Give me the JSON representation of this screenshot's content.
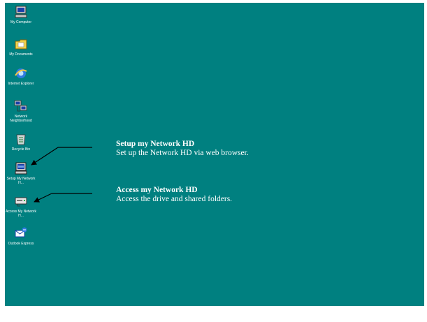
{
  "desktop": {
    "background": "#008080",
    "icons": [
      {
        "label": "My Computer",
        "icon": "my-computer-icon"
      },
      {
        "label": "My Documents",
        "icon": "my-documents-icon"
      },
      {
        "label": "Internet Explorer",
        "icon": "internet-explorer-icon"
      },
      {
        "label": "Network Neighborhood",
        "icon": "network-neighborhood-icon"
      },
      {
        "label": "Recycle Bin",
        "icon": "recycle-bin-icon"
      },
      {
        "label": "Setup My Network H...",
        "icon": "setup-network-hd-icon"
      },
      {
        "label": "Access My Network H...",
        "icon": "access-network-hd-icon"
      },
      {
        "label": "Outlook Express",
        "icon": "outlook-express-icon"
      }
    ]
  },
  "callouts": {
    "setup": {
      "title": "Setup my Network HD",
      "desc": "Set up the Network HD via web browser."
    },
    "access": {
      "title": "Access my Network HD",
      "desc": "Access the drive and shared folders."
    }
  }
}
